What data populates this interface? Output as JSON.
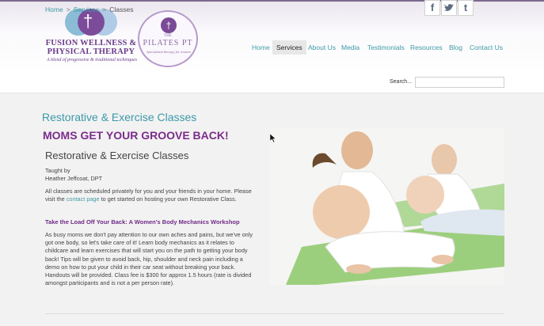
{
  "branding": {
    "logo_line1": "FUSION WELLNESS &",
    "logo_line2": "PHYSICAL THERAPY",
    "tagline": "A blend of progressive & traditional techniques",
    "partner_the": "THE",
    "partner_name": "PILATES PT",
    "partner_sub": "Specialized therapy for women",
    "colors": {
      "purple": "#7a2d8a",
      "teal": "#3d9aa6",
      "light_blue": "#7fb6d1"
    }
  },
  "social": [
    {
      "label": "f",
      "icon": "facebook-icon"
    },
    {
      "label": "❧",
      "icon": "twitter-icon"
    },
    {
      "label": "t",
      "icon": "tumblr-icon"
    }
  ],
  "nav": [
    {
      "label": "Home"
    },
    {
      "label": "Services",
      "active": true
    },
    {
      "label": "About Us"
    },
    {
      "label": "Media"
    },
    {
      "label": "Testimonials"
    },
    {
      "label": "Resources"
    },
    {
      "label": "Blog"
    },
    {
      "label": "Contact Us"
    }
  ],
  "breadcrumb": {
    "home": "Home",
    "services": "Services",
    "current": "Classes",
    "separator": ">"
  },
  "search": {
    "label": "Search..."
  },
  "content": {
    "section_title": "Restorative & Exercise Classes",
    "headline": "MOMS GET YOUR GROOVE BACK!",
    "page_heading": "Restorative & Exercise Classes",
    "taught_by": "Taught by",
    "instructor": "Heather Jeffcoat, DPT",
    "intro_before_link": "All classes are scheduled privately for you and your friends in your home. Please visit the ",
    "intro_link": "contact page",
    "intro_after_link": " to get started on hosting your own Restorative Class.",
    "workshop_title": "Take the Load Off Your Back: A Women's Body Mechanics Workshop",
    "workshop_body": "As busy moms we don't pay attention to our own aches and pains, but we've only got one body, so let's take care of it! Learn body mechanics as it relates to childcare and learn exercises that will start you on the path to getting your body back! Tips will be given to avoid back, hip, shoulder and neck pain including a demo on how to put your child in their car seat without breaking your back. Handouts will be provided. Class fee is $300 for approx 1.5 hours (rate is divided amongst participants and is not a per person rate)."
  }
}
